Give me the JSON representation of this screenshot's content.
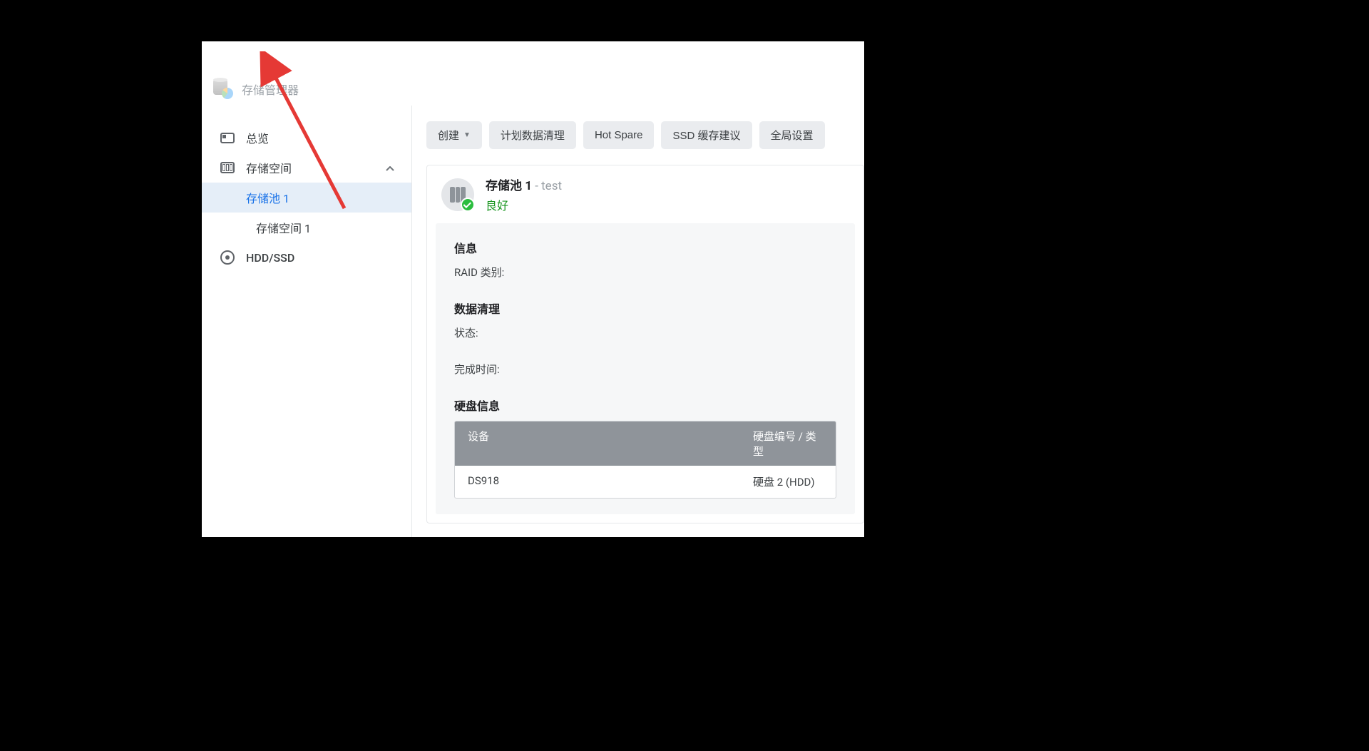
{
  "window": {
    "title": "存储管理器"
  },
  "taskbar": {
    "apps_icon": "apps-icon",
    "storage_icon": "storage-manager-icon"
  },
  "sidebar": {
    "overview": "总览",
    "storage": "存储空间",
    "pool1": "存储池 1",
    "volume1": "存储空间 1",
    "hdd_ssd": "HDD/SSD"
  },
  "toolbar": {
    "create": "创建",
    "scrub": "计划数据清理",
    "hotspare": "Hot Spare",
    "ssd_advisor": "SSD 缓存建议",
    "global": "全局设置"
  },
  "pool": {
    "title": "存储池 1",
    "suffix": " - test",
    "status": "良好",
    "info_heading": "信息",
    "raid_label": "RAID 类别:",
    "scrub_heading": "数据清理",
    "status_label": "状态:",
    "complete_label": "完成时间:",
    "disk_heading": "硬盘信息",
    "table": {
      "col_device": "设备",
      "col_disk": "硬盘编号 / 类型",
      "rows": [
        {
          "device": "DS918",
          "disk": "硬盘 2 (HDD)"
        }
      ]
    }
  }
}
